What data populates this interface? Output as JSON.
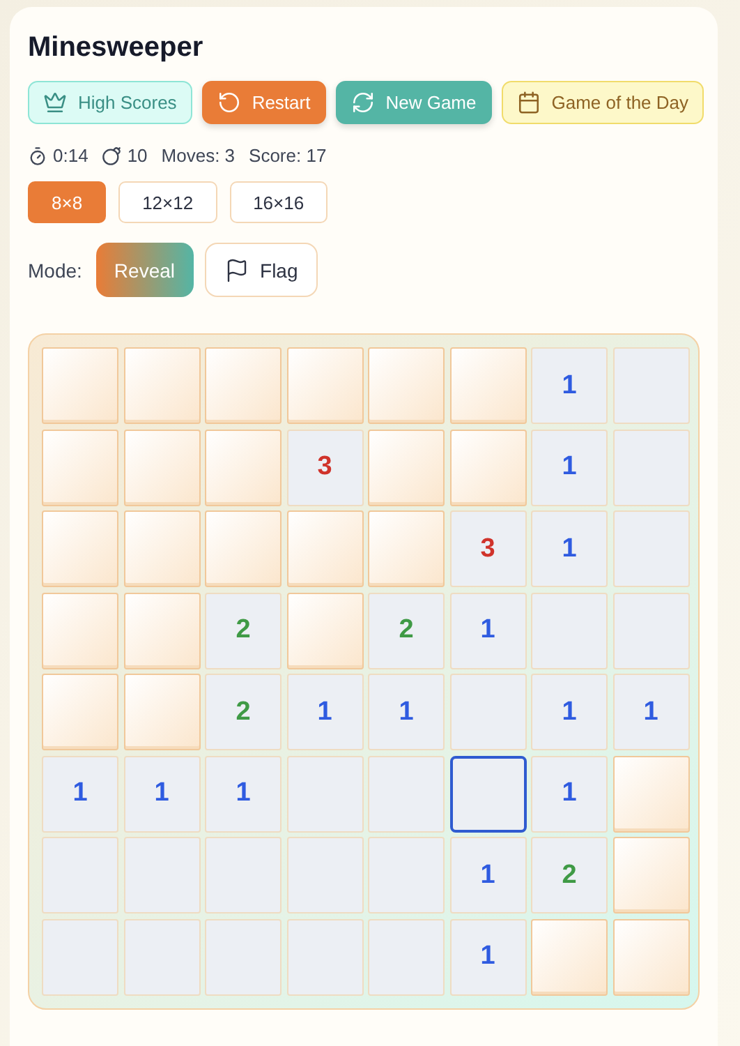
{
  "title": "Minesweeper",
  "actions": [
    {
      "label": "High Scores",
      "kind": "scores"
    },
    {
      "label": "Restart",
      "kind": "restart"
    },
    {
      "label": "New Game",
      "kind": "new"
    },
    {
      "label": "Game of the Day",
      "kind": "daily"
    }
  ],
  "stats": {
    "time": "0:14",
    "mines": "10",
    "moves": "Moves: 3",
    "score": "Score: 17"
  },
  "sizes": [
    {
      "label": "8×8",
      "selected": true
    },
    {
      "label": "12×12",
      "selected": false
    },
    {
      "label": "16×16",
      "selected": false
    }
  ],
  "mode": {
    "label": "Mode:",
    "options": [
      {
        "label": "Reveal",
        "kind": "reveal",
        "selected": true
      },
      {
        "label": "Flag",
        "kind": "flag",
        "selected": false
      }
    ]
  },
  "board": [
    [
      {
        "revealed": false
      },
      {
        "revealed": false
      },
      {
        "revealed": false
      },
      {
        "revealed": false
      },
      {
        "revealed": false
      },
      {
        "revealed": false
      },
      {
        "revealed": true,
        "number": "1",
        "color": "#2f5be0"
      },
      {
        "revealed": true
      }
    ],
    [
      {
        "revealed": false
      },
      {
        "revealed": false
      },
      {
        "revealed": false
      },
      {
        "revealed": true,
        "number": "3",
        "color": "#d0332b"
      },
      {
        "revealed": false
      },
      {
        "revealed": false
      },
      {
        "revealed": true,
        "number": "1",
        "color": "#2f5be0"
      },
      {
        "revealed": true
      }
    ],
    [
      {
        "revealed": false
      },
      {
        "revealed": false
      },
      {
        "revealed": false
      },
      {
        "revealed": false
      },
      {
        "revealed": false
      },
      {
        "revealed": true,
        "number": "3",
        "color": "#d0332b"
      },
      {
        "revealed": true,
        "number": "1",
        "color": "#2f5be0"
      },
      {
        "revealed": true
      }
    ],
    [
      {
        "revealed": false
      },
      {
        "revealed": false
      },
      {
        "revealed": true,
        "number": "2",
        "color": "#3f9a45"
      },
      {
        "revealed": false
      },
      {
        "revealed": true,
        "number": "2",
        "color": "#3f9a45"
      },
      {
        "revealed": true,
        "number": "1",
        "color": "#2f5be0"
      },
      {
        "revealed": true
      },
      {
        "revealed": true
      }
    ],
    [
      {
        "revealed": false
      },
      {
        "revealed": false
      },
      {
        "revealed": true,
        "number": "2",
        "color": "#3f9a45"
      },
      {
        "revealed": true,
        "number": "1",
        "color": "#2f5be0"
      },
      {
        "revealed": true,
        "number": "1",
        "color": "#2f5be0"
      },
      {
        "revealed": true
      },
      {
        "revealed": true,
        "number": "1",
        "color": "#2f5be0"
      },
      {
        "revealed": true,
        "number": "1",
        "color": "#2f5be0"
      }
    ],
    [
      {
        "revealed": true,
        "number": "1",
        "color": "#2f5be0"
      },
      {
        "revealed": true,
        "number": "1",
        "color": "#2f5be0"
      },
      {
        "revealed": true,
        "number": "1",
        "color": "#2f5be0"
      },
      {
        "revealed": true
      },
      {
        "revealed": true
      },
      {
        "revealed": true,
        "selected": true
      },
      {
        "revealed": true,
        "number": "1",
        "color": "#2f5be0"
      },
      {
        "revealed": false
      }
    ],
    [
      {
        "revealed": true
      },
      {
        "revealed": true
      },
      {
        "revealed": true
      },
      {
        "revealed": true
      },
      {
        "revealed": true
      },
      {
        "revealed": true,
        "number": "1",
        "color": "#2f5be0"
      },
      {
        "revealed": true,
        "number": "2",
        "color": "#3f9a45"
      },
      {
        "revealed": false
      }
    ],
    [
      {
        "revealed": true
      },
      {
        "revealed": true
      },
      {
        "revealed": true
      },
      {
        "revealed": true
      },
      {
        "revealed": true
      },
      {
        "revealed": true,
        "number": "1",
        "color": "#2f5be0"
      },
      {
        "revealed": false
      },
      {
        "revealed": false
      }
    ]
  ]
}
